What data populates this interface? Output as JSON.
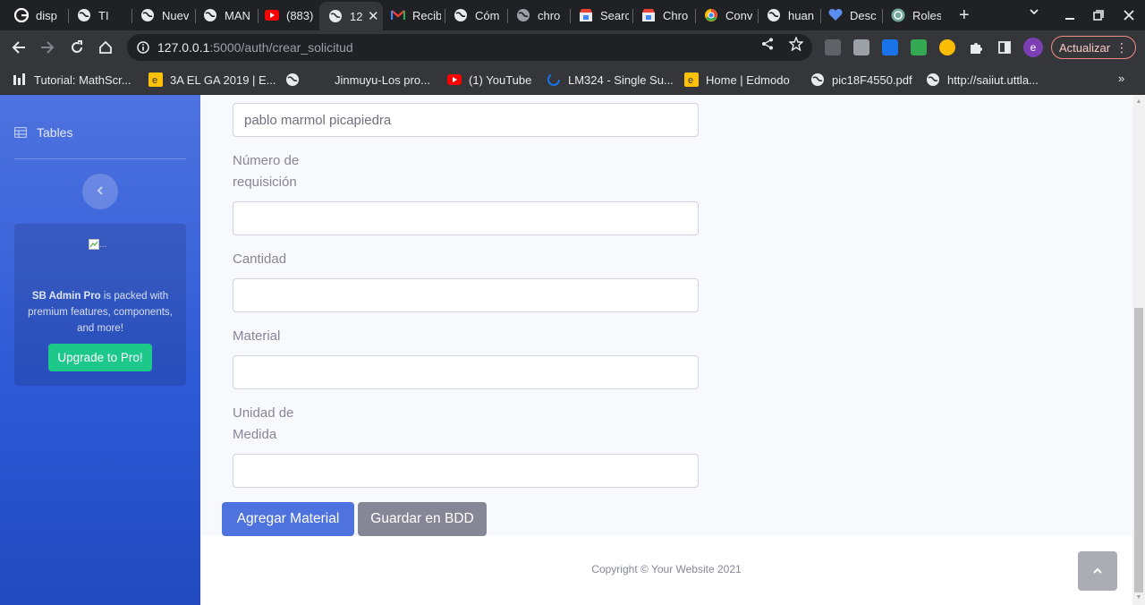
{
  "browser": {
    "tabs": [
      {
        "title": "disp",
        "icon": "google-icon"
      },
      {
        "title": "TI",
        "icon": "globe-icon"
      },
      {
        "title": "Nuev",
        "icon": "globe-icon"
      },
      {
        "title": "MAN",
        "icon": "globe-icon"
      },
      {
        "title": "(883)",
        "icon": "youtube-icon"
      },
      {
        "title": "12",
        "icon": "globe-icon",
        "active": true
      },
      {
        "title": "Recib",
        "icon": "gmail-icon"
      },
      {
        "title": "Cóm",
        "icon": "globe-icon"
      },
      {
        "title": "chro",
        "icon": "globe-icon"
      },
      {
        "title": "Searc",
        "icon": "store-icon"
      },
      {
        "title": "Chro",
        "icon": "store-icon"
      },
      {
        "title": "Conv",
        "icon": "chrome-icon"
      },
      {
        "title": "huan",
        "icon": "globe-icon"
      },
      {
        "title": "Desc",
        "icon": "heart-icon"
      },
      {
        "title": "Roles",
        "icon": "openai-icon"
      }
    ],
    "url_host": "127.0.0.1",
    "url_path": ":5000/auth/crear_solicitud",
    "update_label": "Actualizar",
    "profile_initial": "e"
  },
  "bookmarks": [
    {
      "label": "Tutorial: MathScr...",
      "icon": "bars-icon"
    },
    {
      "label": "3A EL GA 2019 | E...",
      "icon": "edmodo-icon"
    },
    {
      "label": "",
      "icon": "globe-icon"
    },
    {
      "label": "Jinmuyu-Los pro...",
      "icon": "blank-icon"
    },
    {
      "label": "(1) YouTube",
      "icon": "youtube-icon"
    },
    {
      "label": "LM324 - Single Su...",
      "icon": "loading-icon"
    },
    {
      "label": "Home | Edmodo",
      "icon": "edmodo-icon"
    },
    {
      "label": "pic18F4550.pdf",
      "icon": "globe-icon"
    },
    {
      "label": "http://saiiut.uttla...",
      "icon": "globe-icon"
    }
  ],
  "sidebar": {
    "tables_label": "Tables",
    "promo_img_alt": "...",
    "promo_brand": "SB Admin Pro",
    "promo_text": " is packed with premium features, components, and more!",
    "promo_button": "Upgrade to Pro!"
  },
  "form": {
    "name_value": "pablo marmol picapiedra",
    "requisition_label_line1": "Número de",
    "requisition_label_line2": "requisición",
    "quantity_label": "Cantidad",
    "material_label": "Material",
    "unit_label_line1": "Unidad de",
    "unit_label_line2": "Medida",
    "add_button": "Agregar Material",
    "save_button": "Guardar en BDD"
  },
  "footer": {
    "copyright": "Copyright © Your Website 2021"
  },
  "colors": {
    "primary": "#4e73df",
    "secondary": "#858796",
    "success": "#1cc88a"
  }
}
